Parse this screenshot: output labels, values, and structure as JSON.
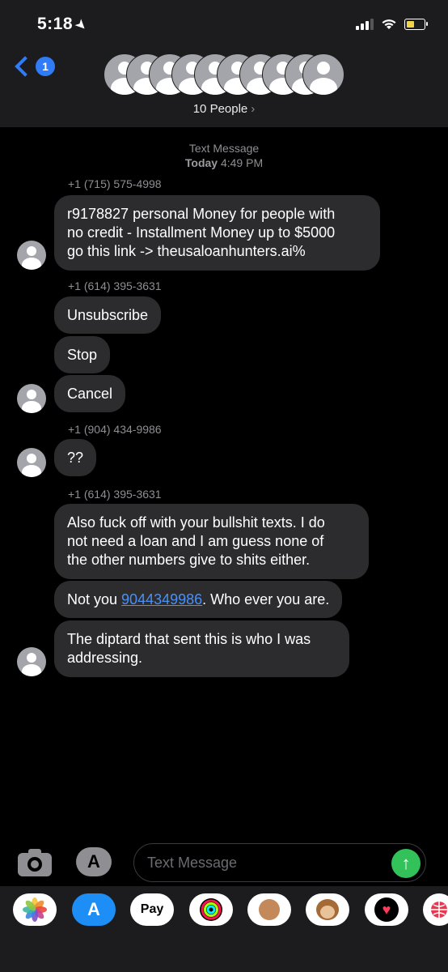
{
  "status_bar": {
    "time": "5:18",
    "location_icon": "location-arrow-icon"
  },
  "header": {
    "unread_count": "1",
    "people_label": "10 People",
    "people_chevron": "›"
  },
  "conversation": {
    "service_label": "Text Message",
    "day_label": "Today",
    "time_label": "4:49 PM",
    "senders": [
      "+1 (715) 575-4998",
      "+1 (614) 395-3631",
      "+1 (904) 434-9986",
      "+1 (614) 395-3631"
    ],
    "messages": [
      {
        "line1": "r9178827  personal Money for people with",
        "line2": "no credit  - Installment Money up to $5000",
        "line3": "go this link ->  theusaloanhunters.ai%"
      },
      {
        "text": "Unsubscribe"
      },
      {
        "text": "Stop"
      },
      {
        "text": "Cancel"
      },
      {
        "text": "??"
      },
      {
        "line1": "Also fuck off with your bullshit texts. I do",
        "line2": "not need a loan and I am guess none of",
        "line3": "the other numbers give to shits either."
      },
      {
        "prefix": "Not you ",
        "link": "9044349986",
        "suffix": ". Who ever you are."
      },
      {
        "line1": "The diptard that sent this is who I was",
        "line2": "addressing."
      }
    ]
  },
  "composer": {
    "placeholder": "Text Message",
    "send_glyph": "↑",
    "appstore_glyph": "A"
  },
  "app_drawer": {
    "apple_pay_label": "Pay",
    "apple_glyph": "",
    "heart_glyph": "♥"
  },
  "colors": {
    "accent_blue": "#2f7cf6",
    "send_green": "#33c15a",
    "bubble_gray": "#2c2c2e"
  }
}
